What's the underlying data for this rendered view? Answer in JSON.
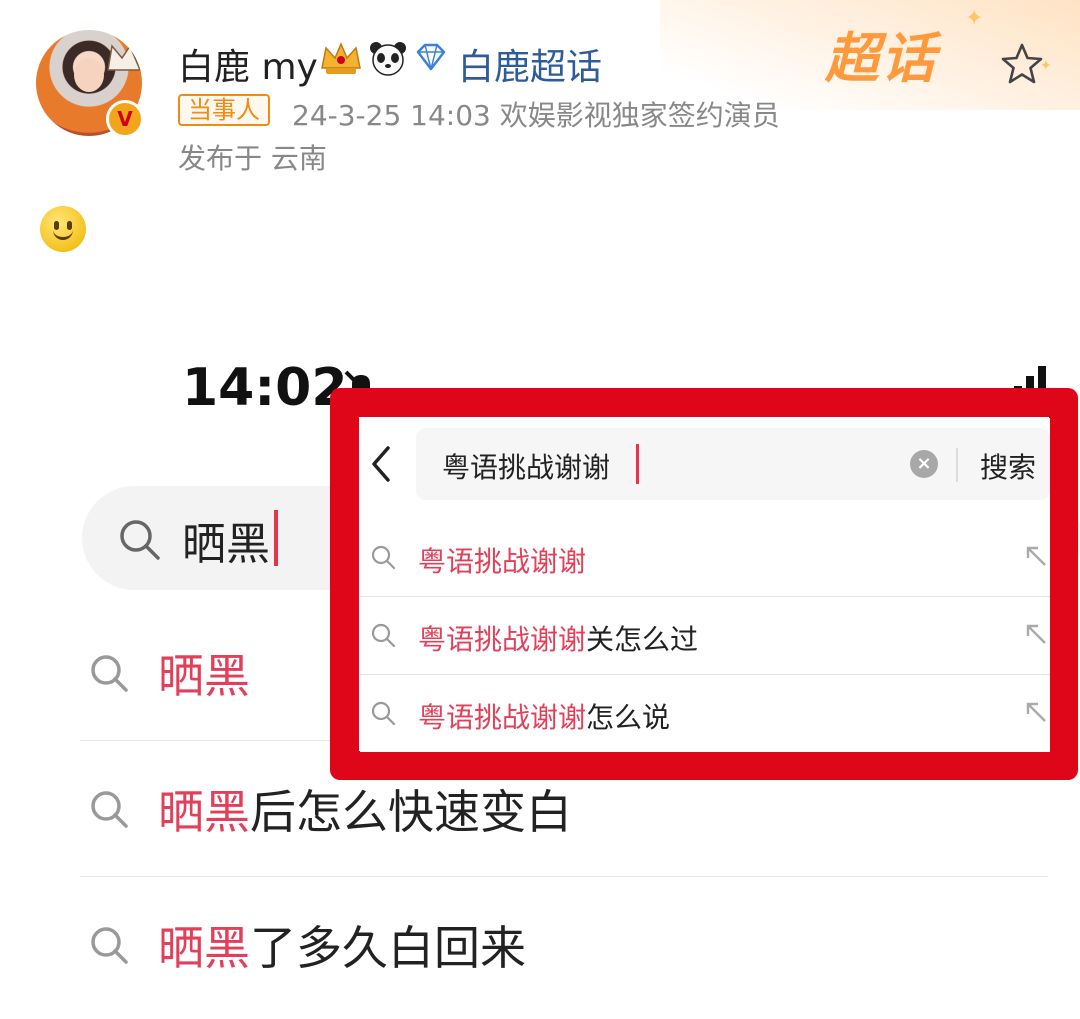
{
  "post": {
    "username": "白鹿 my",
    "supertopic_link": "白鹿超话",
    "supertopic_deco": "超话",
    "role_tag": "当事人",
    "meta": "24-3-25 14:03  欢娱影视独家签约演员",
    "location": "发布于 云南",
    "verified_mark": "V"
  },
  "screenshot": {
    "status_time": "14:02",
    "search_query": "晒黑",
    "suggestions": [
      {
        "highlight": "晒黑",
        "rest": ""
      },
      {
        "highlight": "晒黑",
        "rest": "后怎么快速变白"
      },
      {
        "highlight": "晒黑",
        "rest": "了多久白回来"
      }
    ]
  },
  "overlay": {
    "search_query": "粤语挑战谢谢",
    "submit_label": "搜索",
    "clear_symbol": "×",
    "suggestions": [
      {
        "highlight": "粤语挑战谢谢",
        "rest": ""
      },
      {
        "highlight": "粤语挑战谢谢",
        "rest": "关怎么过"
      },
      {
        "highlight": "粤语挑战谢谢",
        "rest": "怎么说"
      }
    ]
  },
  "colors": {
    "highlight": "#e2405a",
    "frame_red": "#e0061a",
    "link_blue": "#2d5c99",
    "tag_orange": "#f28a14"
  },
  "icons": [
    "star-icon",
    "crown-icon",
    "panda-icon",
    "diamond-icon",
    "mute-icon",
    "signal-icon",
    "search-icon",
    "back-icon",
    "clear-icon",
    "fill-arrow-icon"
  ]
}
